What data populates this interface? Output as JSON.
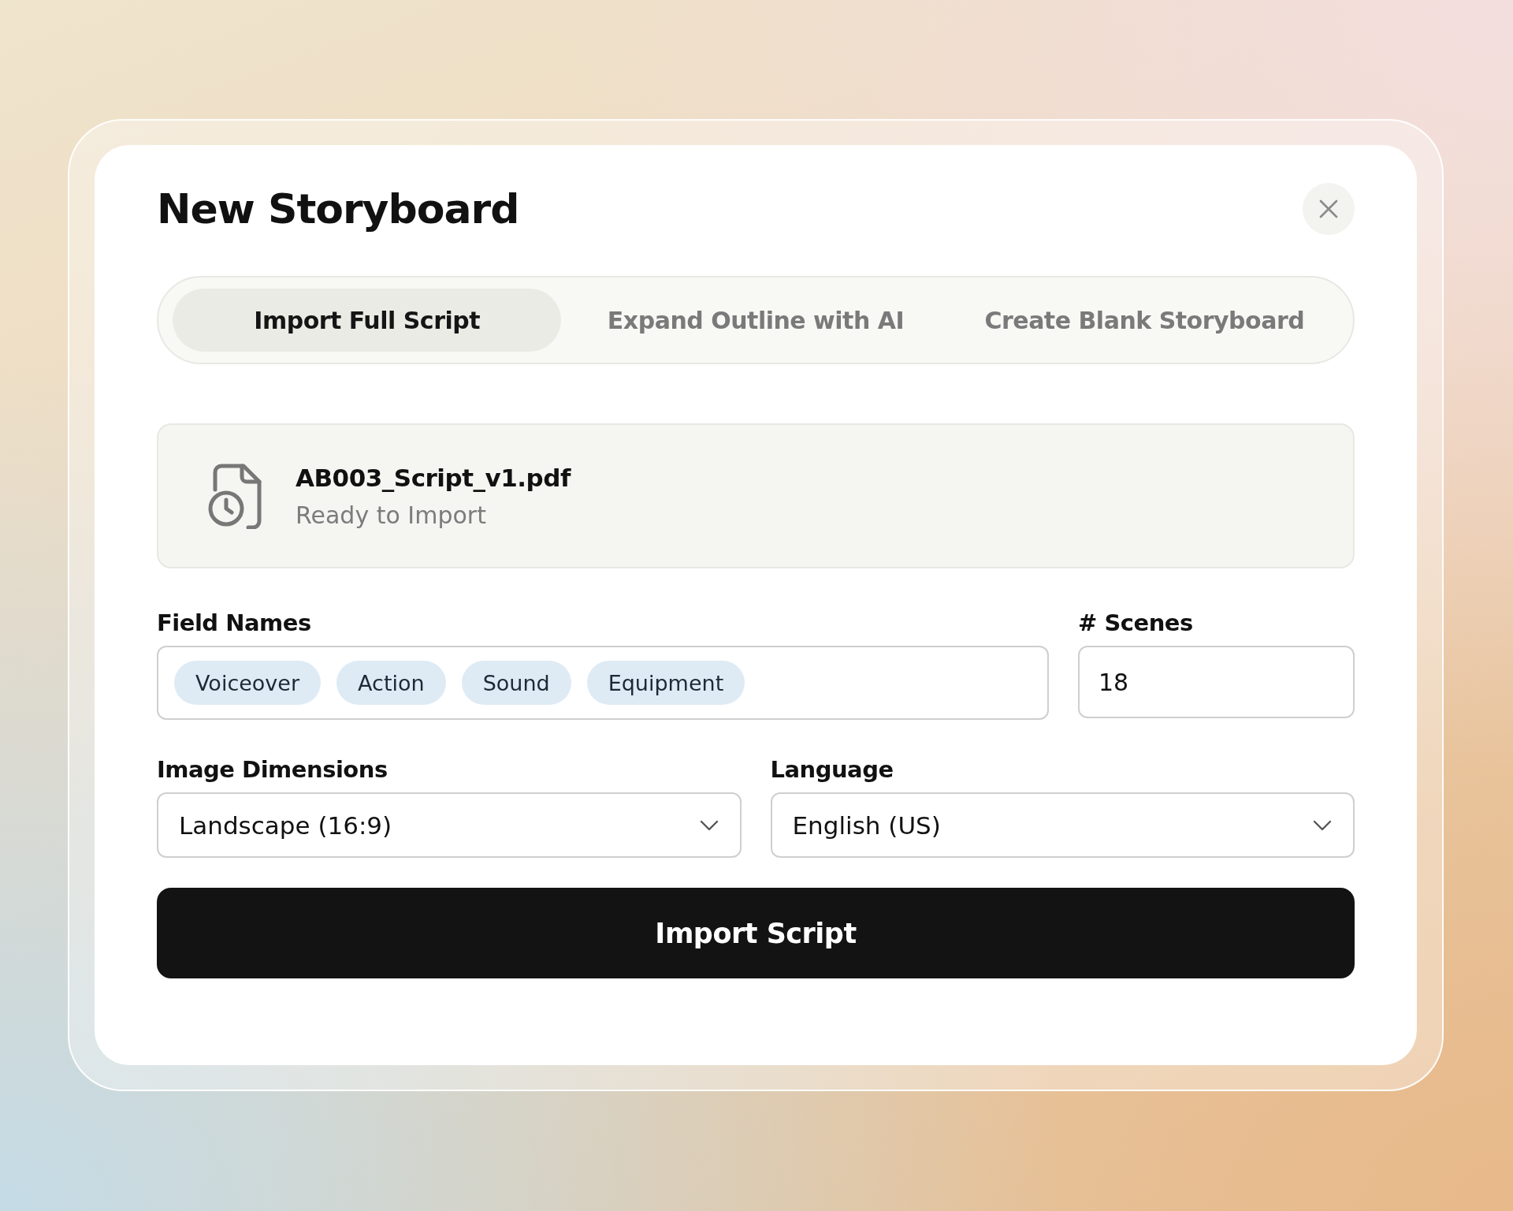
{
  "dialog": {
    "title": "New Storyboard"
  },
  "tabs": [
    {
      "label": "Import Full Script",
      "selected": true
    },
    {
      "label": "Expand Outline with AI",
      "selected": false
    },
    {
      "label": "Create Blank Storyboard",
      "selected": false
    }
  ],
  "file": {
    "name": "AB003_Script_v1.pdf",
    "status": "Ready to Import"
  },
  "field_names": {
    "label": "Field Names",
    "tags": [
      "Voiceover",
      "Action",
      "Sound",
      "Equipment"
    ]
  },
  "scenes": {
    "label": "# Scenes",
    "value": "18"
  },
  "image_dimensions": {
    "label": "Image Dimensions",
    "value": "Landscape (16:9)"
  },
  "language": {
    "label": "Language",
    "value": "English (US)"
  },
  "submit": {
    "label": "Import Script"
  }
}
